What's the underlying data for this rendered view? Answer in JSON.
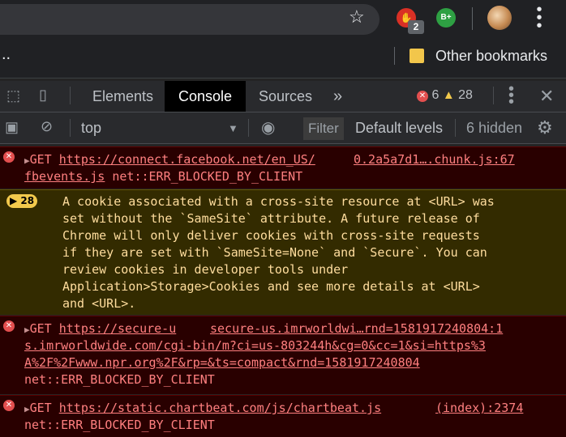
{
  "browser": {
    "bookmarks_ellipsis": "..",
    "other_bookmarks": "Other bookmarks",
    "ext1_badge": "2",
    "ext2_label": "B+"
  },
  "devtools": {
    "tabs": [
      "Elements",
      "Console",
      "Sources"
    ],
    "active_tab": "Console",
    "more_tabs": "»",
    "error_count": "6",
    "warning_count": "28",
    "context": "top",
    "filter_placeholder": "Filter",
    "levels": "Default levels",
    "hidden": "6 hidden"
  },
  "messages": [
    {
      "type": "error",
      "method": "GET",
      "url": "https://connect.facebook.net/en_US/",
      "source": "0.2a5a7d1….chunk.js:67",
      "line2_link": "fbevents.js",
      "line2_text": " net::ERR_BLOCKED_BY_CLIENT"
    },
    {
      "type": "warning",
      "count": "28",
      "lines": [
        "A cookie associated with a cross-site resource at <URL> was",
        "set without the `SameSite` attribute. A future release of",
        "Chrome will only deliver cookies with cross-site requests",
        "if they are set with `SameSite=None` and `Secure`. You can",
        "review cookies in developer tools under",
        "Application>Storage>Cookies and see more details at <URL>",
        "and <URL>."
      ]
    },
    {
      "type": "error",
      "method": "GET",
      "url": "https://secure-u",
      "source": "secure-us.imrworldwi…rnd=1581917240804:1",
      "wrap1": "s.imrworldwide.com/cgi-bin/m?ci=us-803244h&cg=0&cc=1&si=https%3",
      "wrap2": "A%2F%2Fwww.npr.org%2F&rp=&ts=compact&rnd=1581917240804",
      "status": "net::ERR_BLOCKED_BY_CLIENT"
    },
    {
      "type": "error",
      "method": "GET",
      "url": "https://static.chartbeat.com/js/chartbeat.js",
      "source": "(index):2374",
      "status": "net::ERR_BLOCKED_BY_CLIENT"
    }
  ],
  "colors": {
    "error_bg": "#290000",
    "error_text": "#ff8080",
    "warn_bg": "#332b00",
    "warn_text": "#ffdd9e",
    "active_tab_bg": "#000000"
  }
}
